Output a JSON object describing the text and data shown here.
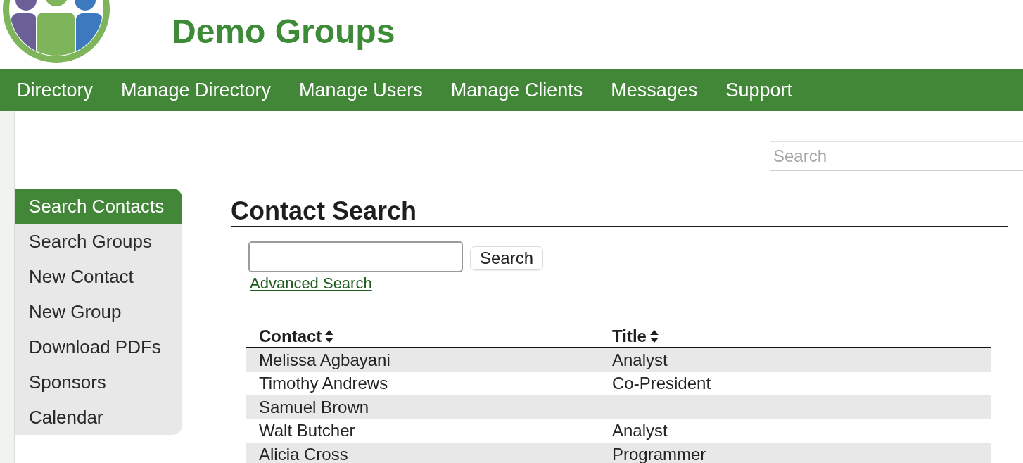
{
  "header": {
    "title": "Demo Groups"
  },
  "nav": {
    "items": [
      {
        "label": "Directory"
      },
      {
        "label": "Manage Directory"
      },
      {
        "label": "Manage Users"
      },
      {
        "label": "Manage Clients"
      },
      {
        "label": "Messages"
      },
      {
        "label": "Support"
      }
    ]
  },
  "site_search": {
    "placeholder": "Search"
  },
  "sidebar": {
    "items": [
      {
        "label": "Search Contacts",
        "selected": true
      },
      {
        "label": "Search Groups",
        "selected": false
      },
      {
        "label": "New Contact",
        "selected": false
      },
      {
        "label": "New Group",
        "selected": false
      },
      {
        "label": "Download PDFs",
        "selected": false
      },
      {
        "label": "Sponsors",
        "selected": false
      },
      {
        "label": "Calendar",
        "selected": false
      }
    ]
  },
  "main": {
    "heading": "Contact Search",
    "search_button": "Search",
    "advanced_link": "Advanced Search"
  },
  "table": {
    "columns": [
      {
        "label": "Contact",
        "sortable": true
      },
      {
        "label": "Title",
        "sortable": true
      }
    ],
    "rows": [
      {
        "contact": "Melissa Agbayani",
        "title": "Analyst"
      },
      {
        "contact": "Timothy Andrews",
        "title": "Co-President"
      },
      {
        "contact": "Samuel Brown"
      },
      {
        "contact": "Walt Butcher",
        "title": "Analyst"
      },
      {
        "contact": "Alicia Cross",
        "title": "Programmer"
      }
    ]
  }
}
